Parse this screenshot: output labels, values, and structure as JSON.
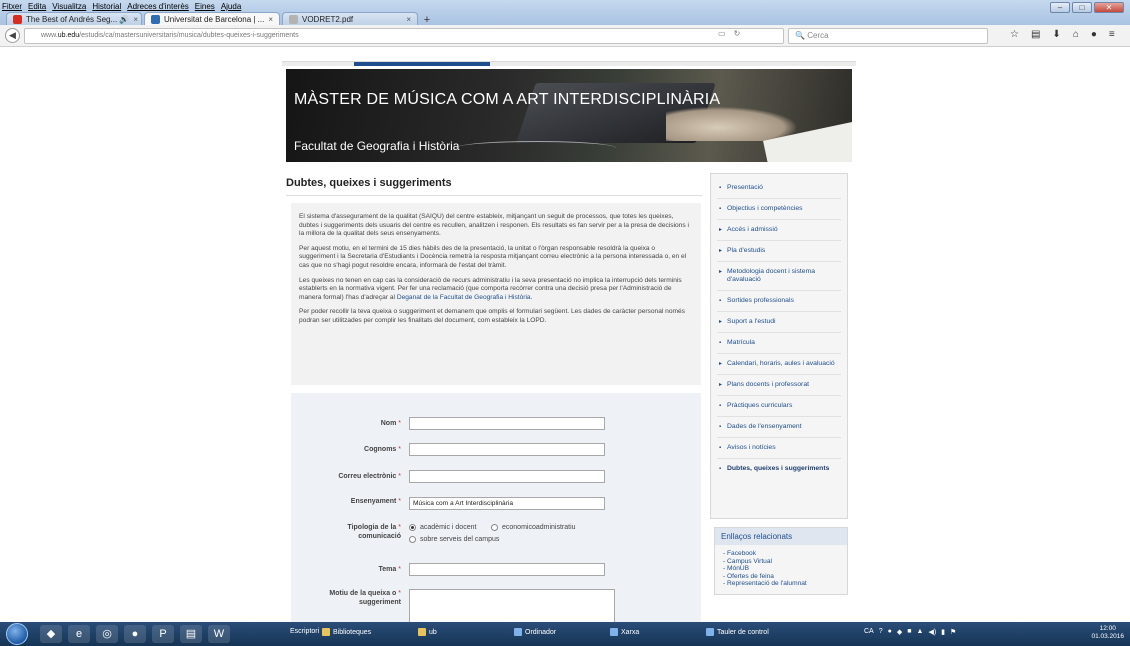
{
  "browser": {
    "menu": [
      "Fitxer",
      "Edita",
      "Visualitza",
      "Historial",
      "Adreces d'interès",
      "Eines",
      "Ajuda"
    ],
    "tabs": [
      {
        "title": "The Best of Andrés Seg... 🔊",
        "close": "×"
      },
      {
        "title": "Universitat de Barcelona | ...",
        "close": "×"
      },
      {
        "title": "VODRET2.pdf",
        "close": "×"
      }
    ],
    "new_tab": "+",
    "url_prefix": "www.",
    "url_domain": "ub.edu",
    "url_path": "/estudis/ca/mastersuniversitaris/musica/dubtes-queixes-i-suggeriments",
    "search_placeholder": "Cerca",
    "icons": [
      "star-icon",
      "bookmarks-icon",
      "download-icon",
      "home-icon",
      "sync-icon",
      "menu-icon"
    ]
  },
  "banner": {
    "title": "MÀSTER DE MÚSICA COM A ART INTERDISCIPLINÀRIA",
    "faculty": "Facultat de Geografia i Història"
  },
  "main": {
    "title": "Dubtes, queixes i suggeriments",
    "paragraphs": [
      "El sistema d'assegurament de la qualitat (SAIQU) del centre estableix, mitjançant un seguit de processos, que totes les queixes, dubtes i suggeriments dels usuaris del centre es recullen, analitzen i responen. Els resultats es fan servir per a la presa de decisions i la millora de la qualitat dels seus ensenyaments.",
      "Per aquest motiu, en el termini de 15 dies hàbils des de la presentació, la unitat o l'òrgan responsable resoldrà la queixa o suggeriment i la Secretaria d'Estudiants i Docència remetrà la resposta mitjançant correu electrònic a la persona interessada o, en el cas que no s'hagi pogut resoldre encara, informarà de l'estat del tràmit.",
      "Les queixes no tenen en cap cas la consideració de recurs administratiu i la seva presentació no implica la interrupció dels terminis establerts en la normativa vigent. Per fer una reclamació (que comporta recórrer contra una decisió presa per l'Administració de manera formal) l'has d'adreçar al ",
      "Per poder recollir la teva queixa o suggeriment et demanem que omplis el formulari següent. Les dades de caràcter personal només podran ser utilitzades per complir les finalitats del document, com estableix la LOPD."
    ],
    "link_text": "Deganat de la Facultat de Geografia i Història",
    "link_suffix": "."
  },
  "form": {
    "required_mark": "*",
    "nom_label": "Nom",
    "cognoms_label": "Cognoms",
    "email_label": "Correu electrònic",
    "ensenyament_label": "Ensenyament",
    "ensenyament_value": "Música com a Art Interdisciplinària",
    "tipologia_label_1": "Tipologia de la",
    "tipologia_label_2": "comunicació",
    "tipologia_options": [
      "acadèmic i docent",
      "economicoadministratiu",
      "sobre serveis del campus"
    ],
    "tipologia_selected": "acadèmic i docent",
    "tema_label": "Tema",
    "motiu_label_1": "Motiu de la queixa o",
    "motiu_label_2": "suggeriment"
  },
  "sidebar": {
    "items": [
      {
        "label": "Presentació",
        "bullet": "▪"
      },
      {
        "label": "Objectius i competències",
        "bullet": "▪"
      },
      {
        "label": "Accés i admissió",
        "bullet": "▸"
      },
      {
        "label": "Pla d'estudis",
        "bullet": "▸"
      },
      {
        "label": "Metodologia docent i sistema d'avaluació",
        "bullet": "▸"
      },
      {
        "label": "Sortides professionals",
        "bullet": "▪"
      },
      {
        "label": "Suport a l'estudi",
        "bullet": "▸"
      },
      {
        "label": "Matrícula",
        "bullet": "▪"
      },
      {
        "label": "Calendari, horaris, aules i avaluació",
        "bullet": "▸"
      },
      {
        "label": "Plans docents i professorat",
        "bullet": "▸"
      },
      {
        "label": "Pràctiques curriculars",
        "bullet": "▪"
      },
      {
        "label": "Dades de l'ensenyament",
        "bullet": "▪"
      },
      {
        "label": "Avisos i notícies",
        "bullet": "▪"
      },
      {
        "label": "Dubtes, queixes i suggeriments",
        "bullet": "▪"
      }
    ]
  },
  "related": {
    "title": "Enllaços relacionats",
    "links": [
      "Facebook",
      "Campus Virtual",
      "MónUB",
      "Ofertes de feina",
      "Representació de l'alumnat"
    ]
  },
  "taskbar": {
    "items": [
      "Escriptori",
      "Biblioteques",
      "ub",
      "Ordinador",
      "Xarxa",
      "Tauler de control"
    ],
    "lang": "CA",
    "time": "12:00",
    "date": "01.03.2016"
  }
}
